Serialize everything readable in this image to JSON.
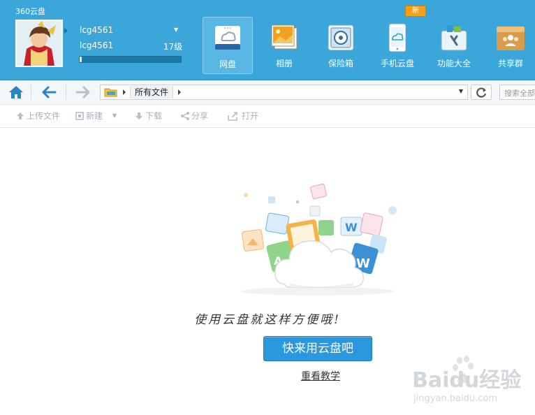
{
  "app": {
    "title": "360云盘"
  },
  "user": {
    "name": "lcg4561",
    "id": "lcg4561",
    "level": "17级",
    "level_progress": 0.02
  },
  "nav": [
    {
      "label": "网盘",
      "icon": "cloud-disk-icon",
      "active": true
    },
    {
      "label": "相册",
      "icon": "photo-album-icon"
    },
    {
      "label": "保险箱",
      "icon": "safe-icon"
    },
    {
      "label": "手机云盘",
      "icon": "mobile-cloud-icon"
    },
    {
      "label": "功能大全",
      "icon": "toolbox-icon"
    },
    {
      "label": "共享群",
      "icon": "share-group-icon"
    }
  ],
  "new_badge": "新",
  "path": {
    "crumb": "所有文件"
  },
  "search": {
    "placeholder": "搜索全部"
  },
  "actions": {
    "upload": "上传文件",
    "new": "新建",
    "download": "下载",
    "share": "分享",
    "open": "打开"
  },
  "empty_state": {
    "tagline": "使用云盘就这样方便哦!",
    "cta": "快来用云盘吧",
    "relearn": "重看教学"
  },
  "watermark": {
    "brand": "Baidu经验",
    "url": "jingyan.baidu.com"
  },
  "colors": {
    "header": "#3aa6d9",
    "cta": "#2b98de",
    "badge": "#f3a21a"
  }
}
